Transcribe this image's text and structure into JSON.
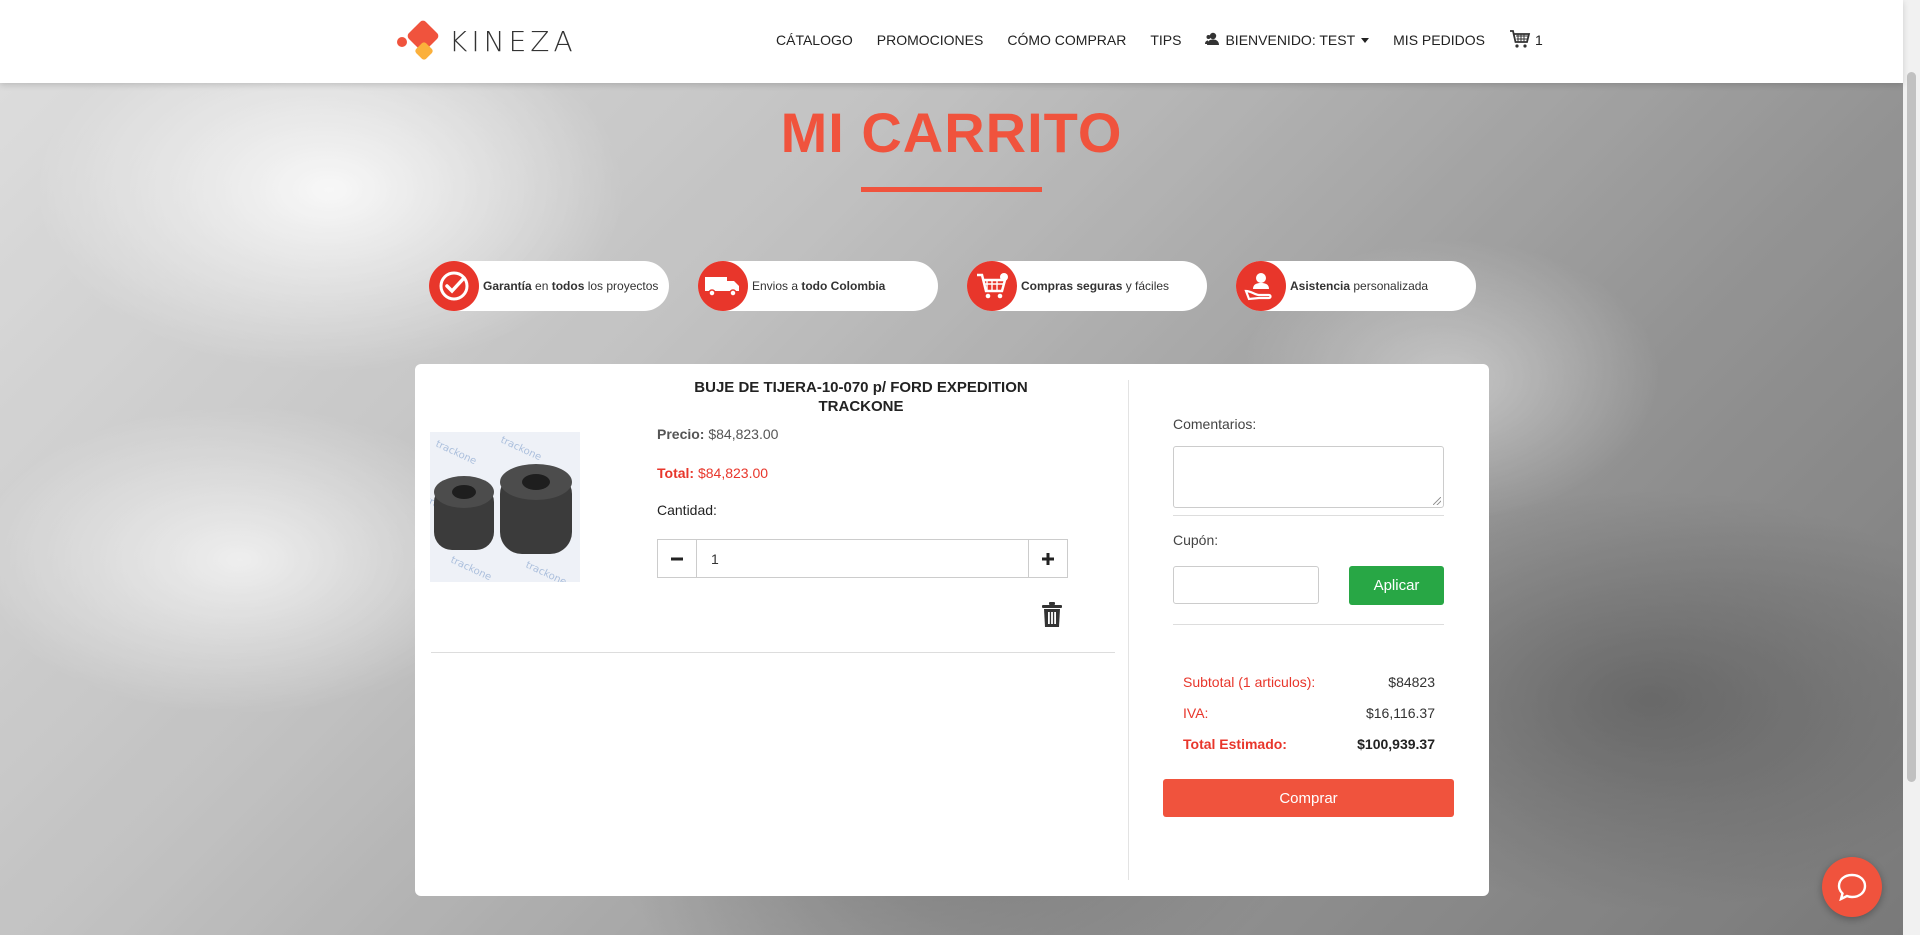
{
  "header": {
    "logo_text": "KINEZA",
    "nav": {
      "catalogo": "CÁTALOGO",
      "promociones": "PROMOCIONES",
      "como_comprar": "CÓMO COMPRAR",
      "tips": "TIPS",
      "bienvenido": "BIENVENIDO: TEST",
      "mis_pedidos": "MIS PEDIDOS",
      "cart_count": "1"
    }
  },
  "page": {
    "title": "MI CARRITO"
  },
  "features": [
    {
      "strong1": "Garantía",
      "mid": " en ",
      "strong2": "todos",
      "rest": " los proyectos"
    },
    {
      "pre": "Envios a ",
      "strong": "todo Colombia"
    },
    {
      "strong": "Compras seguras",
      "rest": " y fáciles"
    },
    {
      "strong": "Asistencia",
      "rest": " personalizada"
    }
  ],
  "product": {
    "name_line1": "BUJE DE TIJERA-10-070 p/ FORD EXPEDITION",
    "name_line2": "TRACKONE",
    "price_label": "Precio:",
    "price_value": "$84,823.00",
    "total_label": "Total:",
    "total_value": "$84,823.00",
    "quantity_label": "Cantidad:",
    "quantity_value": "1",
    "image_watermark": "trackone"
  },
  "summary": {
    "comments_label": "Comentarios:",
    "coupon_label": "Cupón:",
    "apply_label": "Aplicar",
    "subtotal_label": "Subtotal (1 articulos):",
    "subtotal_value": "$84823",
    "iva_label": "IVA:",
    "iva_value": "$16,116.37",
    "total_label": "Total Estimado:",
    "total_value": "$100,939.37",
    "buy_label": "Comprar"
  },
  "colors": {
    "accent": "#f0533d",
    "accent_dark": "#e8362b",
    "success": "#28a745",
    "logo_secondary": "#fbb03b"
  },
  "icons": {
    "cart": "cart-icon",
    "user": "user-icon",
    "check": "check-badge-icon",
    "truck": "truck-icon",
    "shopping_cart": "shopping-cart-icon",
    "support": "support-hand-icon",
    "trash": "trash-icon",
    "chat": "chat-icon"
  }
}
